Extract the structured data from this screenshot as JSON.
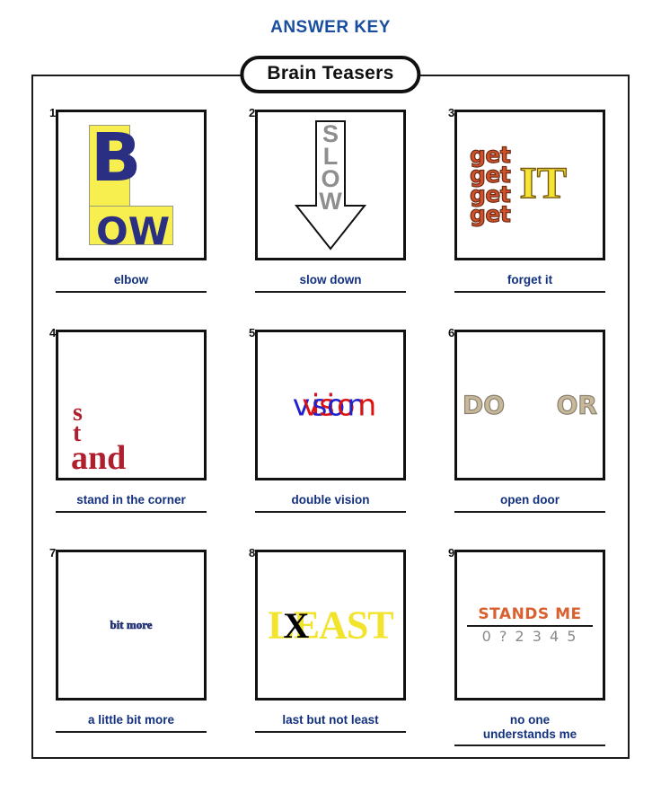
{
  "header": {
    "answer_key_label": "ANSWER KEY",
    "badge_title": "Brain Teasers",
    "title_color": "#1a4fa0",
    "answer_color": "#13317f"
  },
  "puzzles": [
    {
      "number": "1.",
      "answer": "elbow",
      "art": {
        "type": "elbow-l",
        "letter_stem": "B",
        "letter_foot": "OW",
        "bg_color": "#f7ee4f",
        "text_color": "#2b2f84"
      }
    },
    {
      "number": "2.",
      "answer": "slow down",
      "art": {
        "type": "down-arrow",
        "letters": [
          "S",
          "L",
          "O",
          "W"
        ],
        "text_color": "#8e8e8e",
        "outline_color": "#111111"
      }
    },
    {
      "number": "3.",
      "answer": "forget it",
      "art": {
        "type": "get-stack",
        "repeated_word": "get",
        "repeat_count": 4,
        "side_word": "IT",
        "get_color": "#d1502a",
        "it_color": "#f5e533"
      }
    },
    {
      "number": "4.",
      "answer": "stand in the corner",
      "art": {
        "type": "corner-stand",
        "lines": [
          "s",
          "t",
          "and"
        ],
        "text_color": "#b01f2e"
      }
    },
    {
      "number": "5.",
      "answer": "double vision",
      "art": {
        "type": "doubled-word",
        "word": "vision",
        "doubled_text": "wiissiioomm",
        "color_a": "#2222cc",
        "color_b": "#dd1111"
      }
    },
    {
      "number": "6.",
      "answer": "open door",
      "art": {
        "type": "split-word",
        "left": "DO",
        "right": "OR",
        "text_color": "#c8b89a"
      }
    },
    {
      "number": "7.",
      "answer": "a little bit more",
      "art": {
        "type": "tiny-text",
        "text": "bit more",
        "text_color": "#2b3f94"
      }
    },
    {
      "number": "8.",
      "answer": "last but not least",
      "art": {
        "type": "crossed-word",
        "word": "LEAST",
        "cross": "X",
        "text_color": "#f2e32c",
        "cross_color": "#000000"
      }
    },
    {
      "number": "9.",
      "answer": "no one\nunderstands me",
      "art": {
        "type": "fraction",
        "numerator": "STANDS ME",
        "denominator": "0 ? 2 3 4 5",
        "numerator_color": "#d9602f",
        "denominator_color": "#8a8a8a"
      }
    }
  ]
}
